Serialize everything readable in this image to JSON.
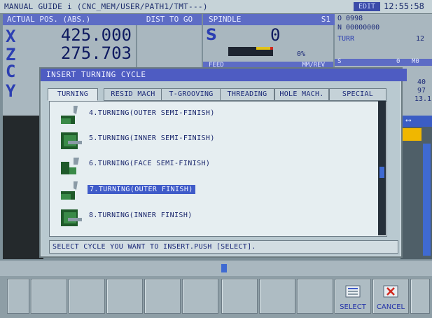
{
  "title_bar": {
    "text": "MANUAL GUIDE i (CNC_MEM/USER/PATH1/TMT---)",
    "mode_badge": "EDIT",
    "clock": "12:55:58"
  },
  "position_panel": {
    "header": "ACTUAL POS. (ABS.)",
    "axes": [
      {
        "axis": "X",
        "value": "425.000"
      },
      {
        "axis": "Z",
        "value": "275.703"
      },
      {
        "axis": "C",
        "value": ""
      },
      {
        "axis": "Y",
        "value": ""
      }
    ]
  },
  "dist_panel": {
    "header": "DIST TO GO"
  },
  "spindle_panel": {
    "header": "SPINDLE",
    "spindle_id": "S1",
    "letter": "S",
    "value": "0",
    "load_percent": "0%",
    "feed_label": "FEED",
    "feed_unit": "MM/REV"
  },
  "right_panel": {
    "program": "O 0998",
    "sequence": "N 00000000",
    "turret_label": "TURR",
    "turret_value": "12",
    "s_label": "S",
    "s_value": "0",
    "m_value": "M0",
    "values": [
      "40",
      "97",
      "13.1"
    ]
  },
  "dialog": {
    "title": "INSERT TURNING CYCLE",
    "tabs": [
      {
        "label": "TURNING",
        "active": true
      },
      {
        "label": "RESID MACH",
        "active": false
      },
      {
        "label": "T-GROOVING",
        "active": false
      },
      {
        "label": "THREADING",
        "active": false
      },
      {
        "label": "HOLE MACH.",
        "active": false
      },
      {
        "label": "SPECIAL",
        "active": false
      }
    ],
    "items": [
      {
        "label": "4.TURNING(OUTER SEMI-FINISH)",
        "icon": "outer-turning-icon",
        "selected": false
      },
      {
        "label": "5.TURNING(INNER SEMI-FINISH)",
        "icon": "inner-turning-icon",
        "selected": false
      },
      {
        "label": "6.TURNING(FACE SEMI-FINISH)",
        "icon": "face-turning-icon",
        "selected": false
      },
      {
        "label": "7.TURNING(OUTER FINISH)",
        "icon": "outer-turning-icon",
        "selected": true
      },
      {
        "label": "8.TURNING(INNER FINISH)",
        "icon": "inner-turning-icon",
        "selected": false
      }
    ],
    "status": "SELECT CYCLE YOU WANT TO INSERT.PUSH [SELECT]."
  },
  "softkeys": [
    {
      "label": ""
    },
    {
      "label": ""
    },
    {
      "label": ""
    },
    {
      "label": ""
    },
    {
      "label": ""
    },
    {
      "label": ""
    },
    {
      "label": ""
    },
    {
      "label": ""
    },
    {
      "label": ""
    },
    {
      "label": "SELECT",
      "icon": "select-icon"
    },
    {
      "label": "CANCEL",
      "icon": "cancel-icon"
    },
    {
      "label": ""
    }
  ],
  "colors": {
    "header_blue": "#5d6cc5",
    "selection_blue": "#3f5bc9",
    "text_navy": "#18256b"
  }
}
